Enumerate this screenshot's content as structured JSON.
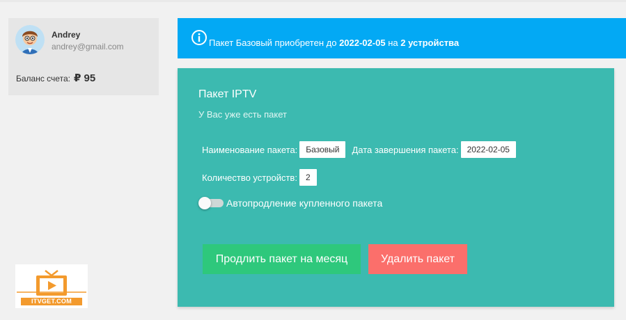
{
  "user": {
    "name": "Andrey",
    "email": "andrey@gmail.com",
    "balance_label": "Баланс счета:",
    "balance_value": "₽ 95"
  },
  "logo": {
    "text": "ITVGET.COM"
  },
  "banner": {
    "prefix": "Пакет Базовый приобретен до",
    "date": "2022-02-05",
    "middle": "на",
    "devices": "2 устройства",
    "icon": "info-icon",
    "color": "#03a9f4"
  },
  "package": {
    "title": "Пакет IPTV",
    "subtitle": "У Вас уже есть пакет",
    "name_label": "Наименование пакета:",
    "name_value": "Базовый",
    "end_label": "Дата завершения пакета:",
    "end_value": "2022-02-05",
    "devices_label": "Количество устройств:",
    "devices_value": "2",
    "autorenew_label": "Автопродление купленного пакета",
    "autorenew_enabled": false,
    "extend_button": "Продлить пакет на месяц",
    "delete_button": "Удалить пакет",
    "card_color": "#3cbab0",
    "extend_color": "#2ec87c",
    "delete_color": "#fb6f6b"
  }
}
